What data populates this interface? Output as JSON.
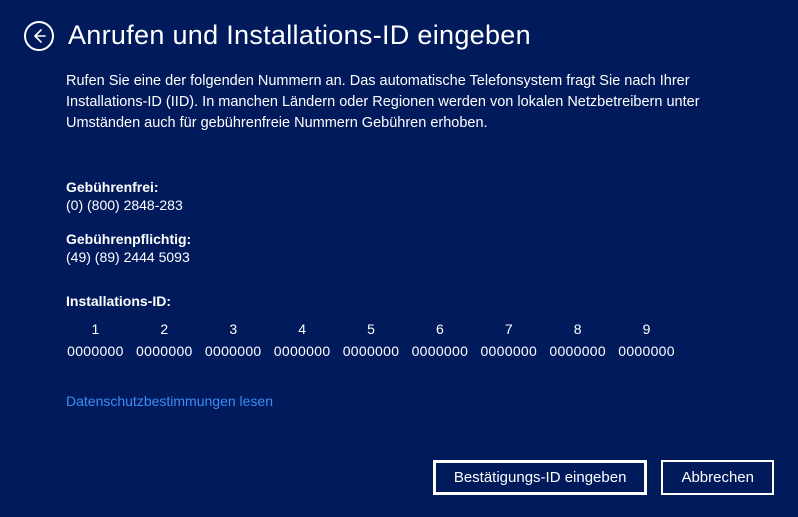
{
  "colors": {
    "bg": "#001a5c",
    "text": "#ffffff",
    "link": "#3d8df5"
  },
  "header": {
    "title": "Anrufen und Installations-ID eingeben"
  },
  "intro": "Rufen Sie eine der folgenden Nummern an. Das automatische Telefonsystem fragt Sie nach Ihrer Installations-ID (IID). In manchen Ländern oder Regionen werden von lokalen Netzbetreibern unter Umständen auch für gebührenfreie Nummern Gebühren erhoben.",
  "phone": {
    "tollfree_label": "Gebührenfrei:",
    "tollfree_number": "(0) (800) 2848-283",
    "toll_label": "Gebührenpflichtig:",
    "toll_number": "(49) (89) 2444 5093"
  },
  "iid": {
    "label": "Installations-ID:",
    "headers": [
      "1",
      "2",
      "3",
      "4",
      "5",
      "6",
      "7",
      "8",
      "9"
    ],
    "values": [
      "0000000",
      "0000000",
      "0000000",
      "0000000",
      "0000000",
      "0000000",
      "0000000",
      "0000000",
      "0000000"
    ]
  },
  "privacy_link": "Datenschutzbestimmungen lesen",
  "footer": {
    "primary": "Bestätigungs-ID eingeben",
    "cancel": "Abbrechen"
  }
}
